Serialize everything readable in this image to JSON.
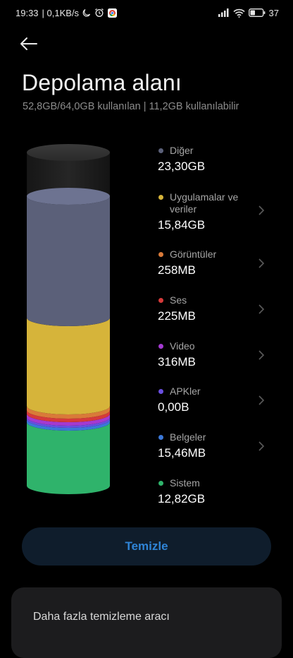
{
  "status_bar": {
    "time": "19:33",
    "net_speed": "| 0,1KB/s",
    "battery": "37"
  },
  "header": {
    "title": "Depolama alanı",
    "subtitle": "52,8GB/64,0GB kullanılan | 11,2GB kullanılabilir"
  },
  "categories": [
    {
      "name": "Diğer",
      "size": "23,30GB",
      "color": "#5b6079"
    },
    {
      "name": "Uygulamalar ve veriler",
      "size": "15,84GB",
      "color": "#d6b43a"
    },
    {
      "name": "Görüntüler",
      "size": "258MB",
      "color": "#d97a39"
    },
    {
      "name": "Ses",
      "size": "225MB",
      "color": "#d63a3a"
    },
    {
      "name": "Video",
      "size": "316MB",
      "color": "#a43ad1"
    },
    {
      "name": "APKler",
      "size": "0,00B",
      "color": "#6a4fe0"
    },
    {
      "name": "Belgeler",
      "size": "15,46MB",
      "color": "#3b78d8"
    },
    {
      "name": "Sistem",
      "size": "12,82GB",
      "color": "#2fb36b"
    }
  ],
  "actions": {
    "clean_label": "Temizle"
  },
  "more_card": {
    "label": "Daha fazla temizleme aracı"
  }
}
